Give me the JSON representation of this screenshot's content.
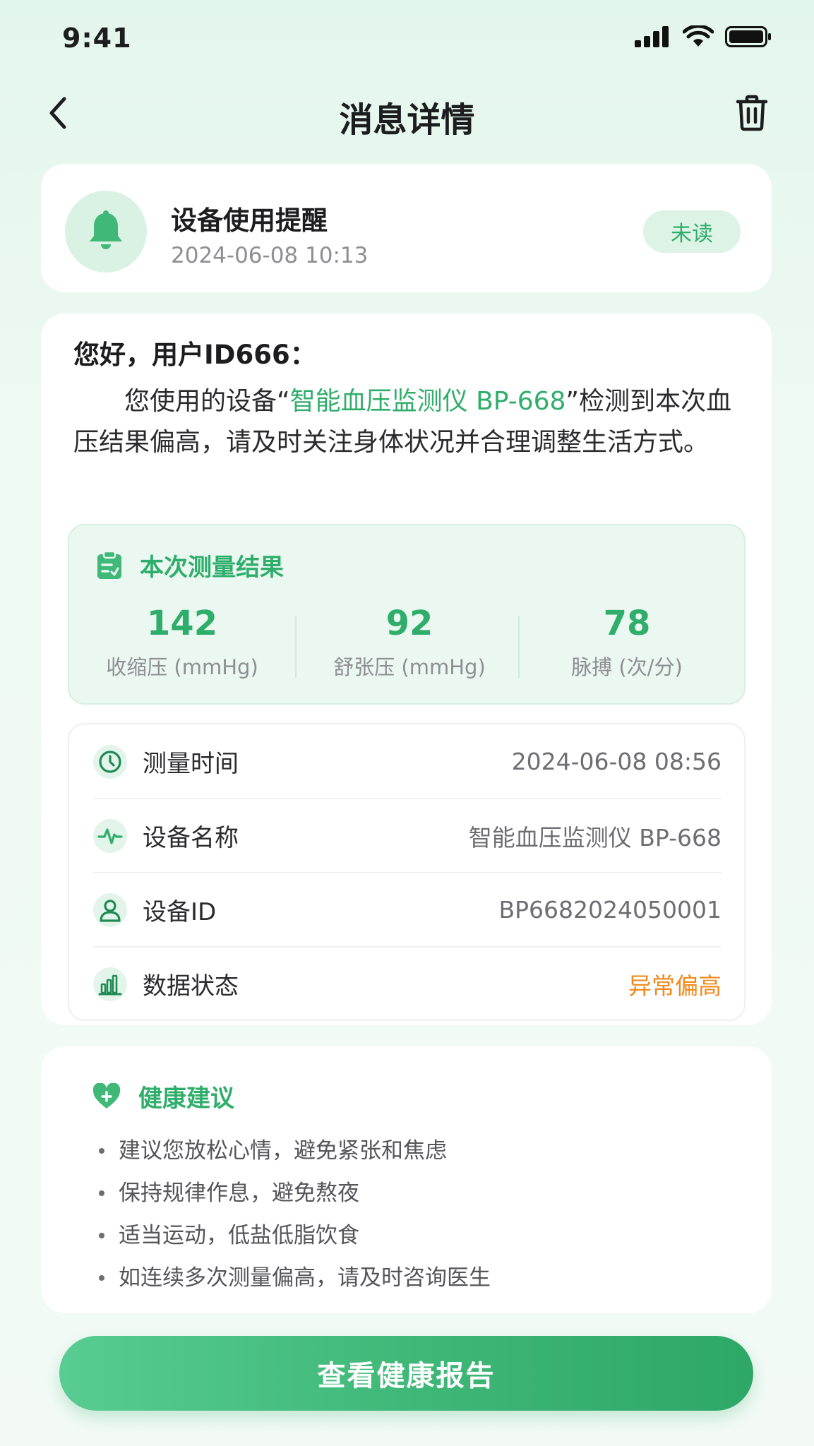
{
  "status_bar": {
    "time": "9:41"
  },
  "nav": {
    "title": "消息详情"
  },
  "message": {
    "title": "设备使用提醒",
    "date": "2024-06-08 10:13",
    "badge": "未读"
  },
  "body": {
    "greeting": "您好，用户ID666：",
    "text_before": "您使用的设备“",
    "device_highlight": "智能血压监测仪 BP-668",
    "text_after": "”检测到本次血压结果偏高，请及时关注身体状况并合理调整生活方式。"
  },
  "result": {
    "title": "本次测量结果",
    "metrics": [
      {
        "value": "142",
        "label": "收缩压 (mmHg)"
      },
      {
        "value": "92",
        "label": "舒张压 (mmHg)"
      },
      {
        "value": "78",
        "label": "脉搏 (次/分)"
      }
    ]
  },
  "info": {
    "rows": [
      {
        "icon": "clock-icon",
        "label": "测量时间",
        "value": "2024-06-08 08:56"
      },
      {
        "icon": "pulse-icon",
        "label": "设备名称",
        "value": "智能血压监测仪 BP-668"
      },
      {
        "icon": "user-icon",
        "label": "设备ID",
        "value": "BP6682024050001"
      },
      {
        "icon": "bar-chart-icon",
        "label": "数据状态",
        "value": "异常偏高"
      }
    ],
    "warn_color": "#f08a1c"
  },
  "advice": {
    "title": "健康建议",
    "items": [
      "建议您放松心情，避免紧张和焦虑",
      "保持规律作息，避免熬夜",
      "适当运动，低盐低脂饮食",
      "如连续多次测量偏高，请及时咨询医生"
    ]
  },
  "cta": {
    "label": "查看健康报告"
  },
  "colors": {
    "accent": "#2fae6b",
    "warning": "#f08a1c"
  }
}
